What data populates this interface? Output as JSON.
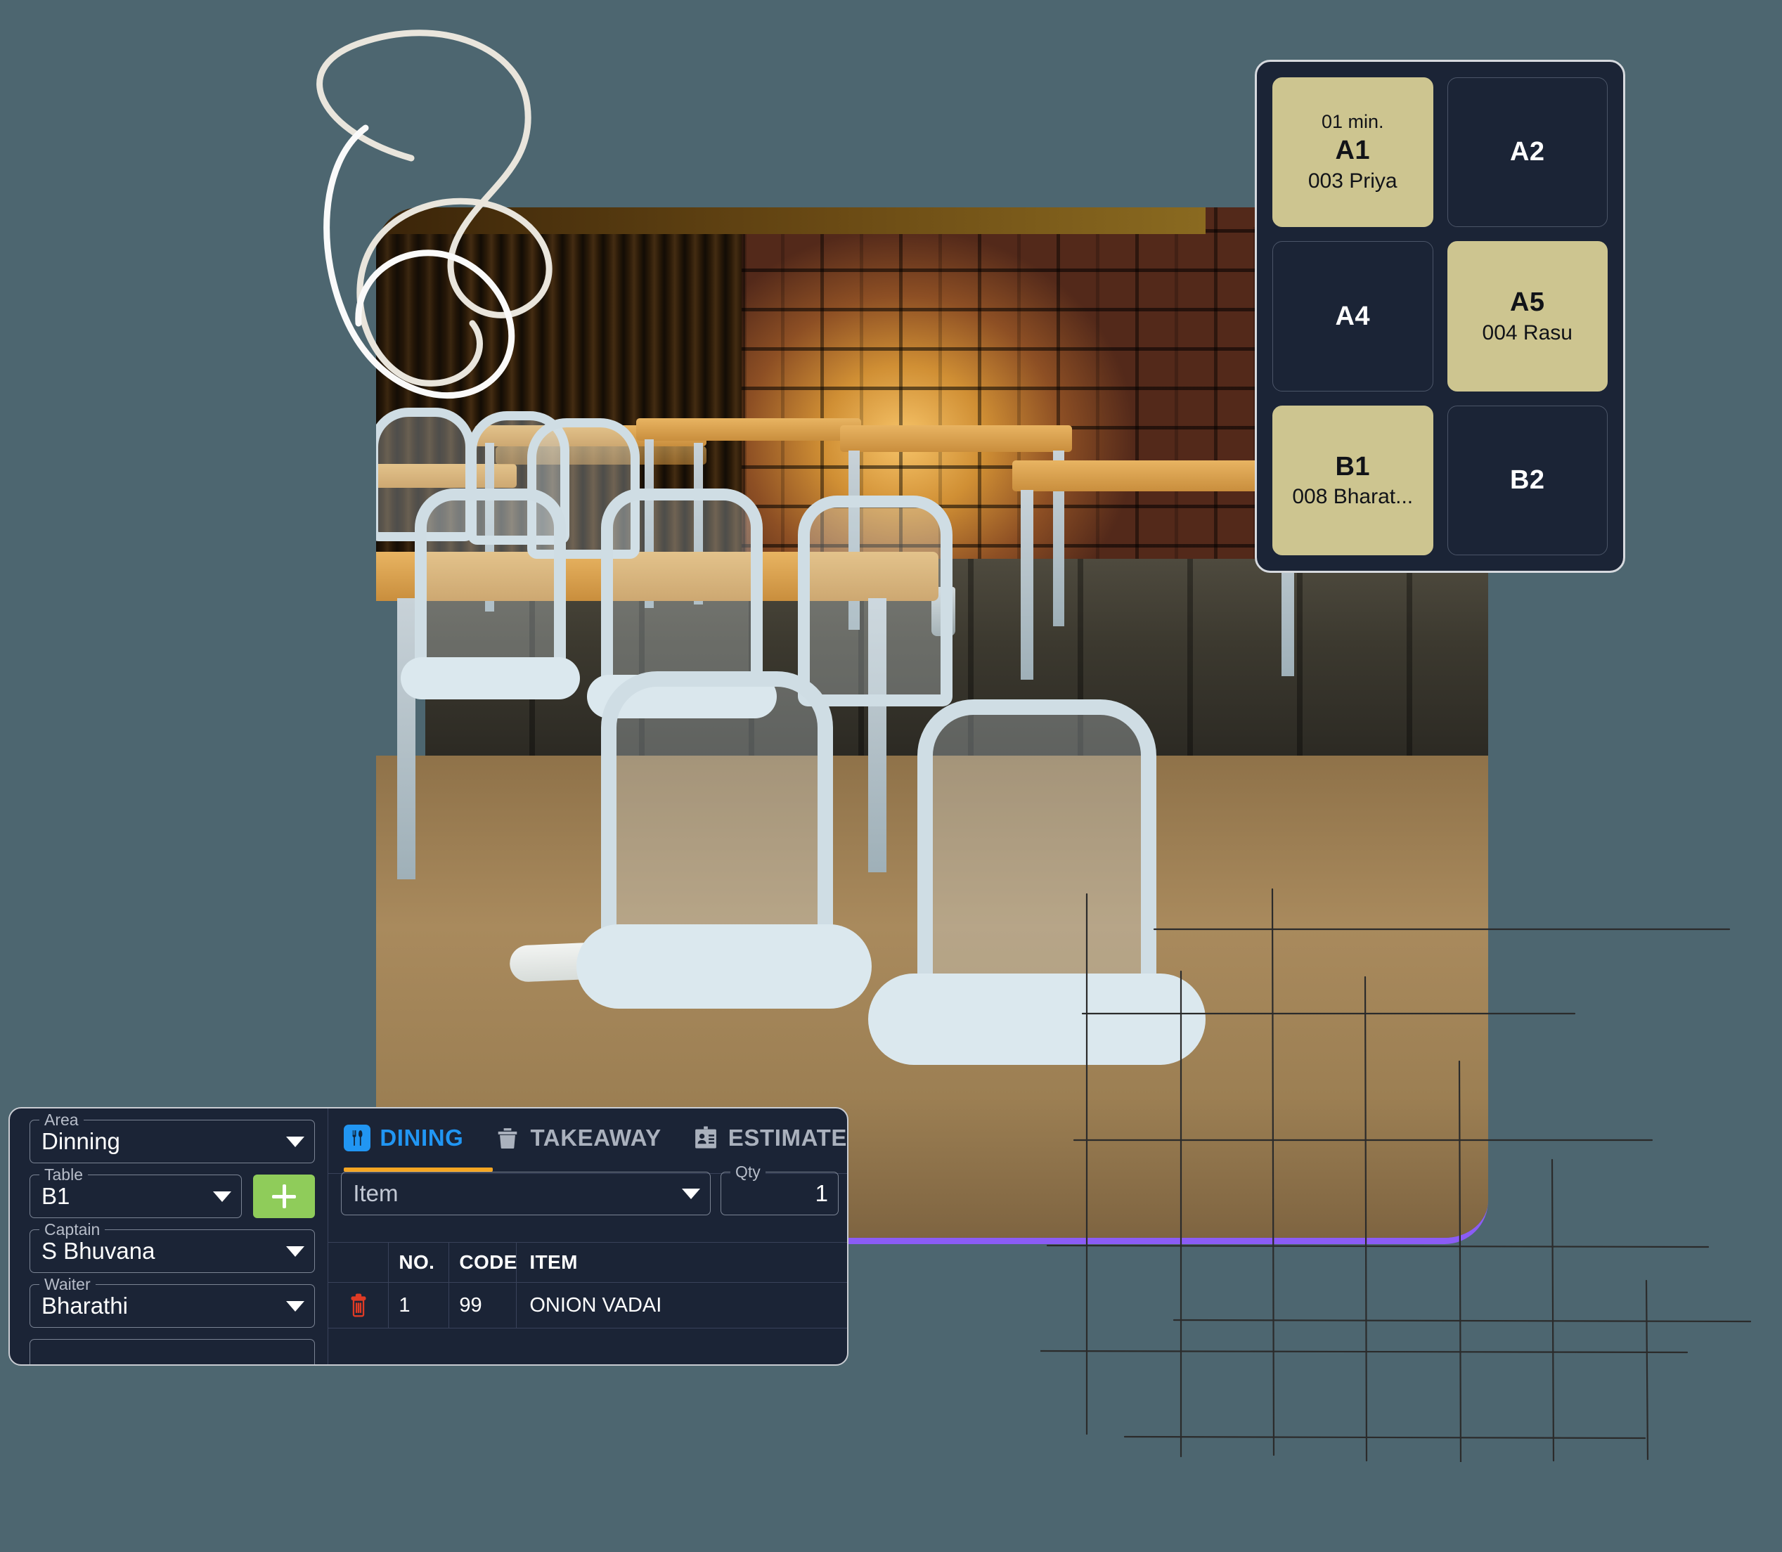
{
  "theme": {
    "background": "#4d6670",
    "panel_bg": "#1b2436",
    "panel_border": "#c9ccd2",
    "accent_blue": "#2196f3",
    "accent_orange": "#f5a623",
    "accent_green": "#8fcc5a",
    "accent_purple": "#8b5cf6",
    "table_busy": "#cdc590",
    "trash_red": "#e03b25"
  },
  "tables_popup": {
    "tiles": [
      {
        "name": "A1",
        "timer": "01 min.",
        "customer": "003 Priya",
        "status": "occupied"
      },
      {
        "name": "A2",
        "timer": "",
        "customer": "",
        "status": "free"
      },
      {
        "name": "A4",
        "timer": "",
        "customer": "",
        "status": "free"
      },
      {
        "name": "A5",
        "timer": "",
        "customer": "004 Rasu",
        "status": "occupied"
      },
      {
        "name": "B1",
        "timer": "",
        "customer": "008 Bharat...",
        "status": "occupied"
      },
      {
        "name": "B2",
        "timer": "",
        "customer": "",
        "status": "free"
      }
    ]
  },
  "order_panel": {
    "fields": {
      "area": {
        "label": "Area",
        "value": "Dinning"
      },
      "table": {
        "label": "Table",
        "value": "B1"
      },
      "captain": {
        "label": "Captain",
        "value": "S Bhuvana"
      },
      "waiter": {
        "label": "Waiter",
        "value": "Bharathi"
      }
    },
    "add_button": {
      "label": "+",
      "icon": "plus-icon"
    },
    "tabs": [
      {
        "label": "DINING",
        "icon": "cutlery-icon",
        "active": true
      },
      {
        "label": "TAKEAWAY",
        "icon": "takeaway-box-icon",
        "active": false
      },
      {
        "label": "ESTIMATE",
        "icon": "id-badge-icon",
        "active": false
      }
    ],
    "item_entry": {
      "item_placeholder": "Item",
      "item_value": "",
      "qty_label": "Qty",
      "qty_value": "1"
    },
    "order_table": {
      "columns": [
        "",
        "NO.",
        "CODE",
        "ITEM"
      ],
      "rows": [
        {
          "delete_icon": "trash-icon",
          "no": "1",
          "code": "99",
          "item": "ONION VADAI"
        }
      ]
    }
  }
}
